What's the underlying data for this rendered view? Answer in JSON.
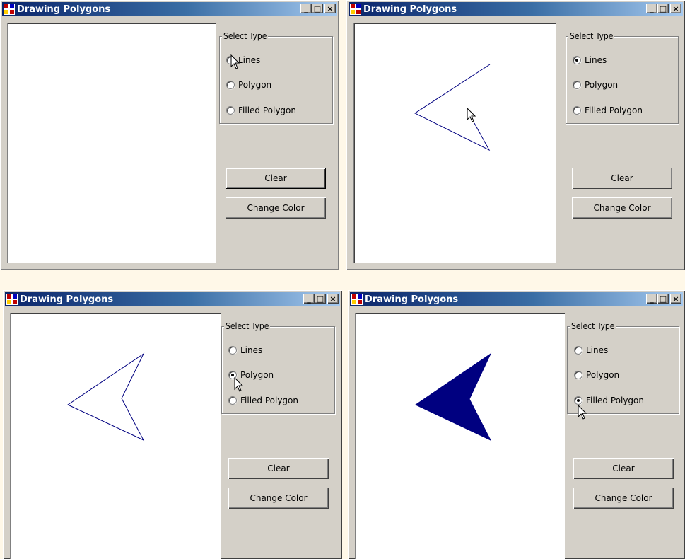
{
  "colors": {
    "polygon": "#000080",
    "title_start": "#0a246a",
    "title_end": "#a6caf0"
  },
  "windows": [
    {
      "title": "Drawing Polygons",
      "controls": {
        "minimize": "_",
        "maximize": "□",
        "close": "×"
      },
      "group_label": "Select Type",
      "options": [
        "Lines",
        "Polygon",
        "Filled Polygon"
      ],
      "selected": null,
      "clear_label": "Clear",
      "change_color_label": "Change Color",
      "drawing_mode": "none",
      "clear_focused": true
    },
    {
      "title": "Drawing Polygons",
      "controls": {
        "minimize": "_",
        "maximize": "□",
        "close": "×"
      },
      "group_label": "Select Type",
      "options": [
        "Lines",
        "Polygon",
        "Filled Polygon"
      ],
      "selected": "Lines",
      "clear_label": "Clear",
      "change_color_label": "Change Color",
      "drawing_mode": "lines",
      "clear_focused": false
    },
    {
      "title": "Drawing Polygons",
      "controls": {
        "minimize": "_",
        "maximize": "□",
        "close": "×"
      },
      "group_label": "Select Type",
      "options": [
        "Lines",
        "Polygon",
        "Filled Polygon"
      ],
      "selected": "Polygon",
      "clear_label": "Clear",
      "change_color_label": "Change Color",
      "drawing_mode": "polygon",
      "clear_focused": false
    },
    {
      "title": "Drawing Polygons",
      "controls": {
        "minimize": "_",
        "maximize": "□",
        "close": "×"
      },
      "group_label": "Select Type",
      "options": [
        "Lines",
        "Polygon",
        "Filled Polygon"
      ],
      "selected": "Filled Polygon",
      "clear_label": "Clear",
      "change_color_label": "Change Color",
      "drawing_mode": "filled",
      "clear_focused": false
    }
  ]
}
